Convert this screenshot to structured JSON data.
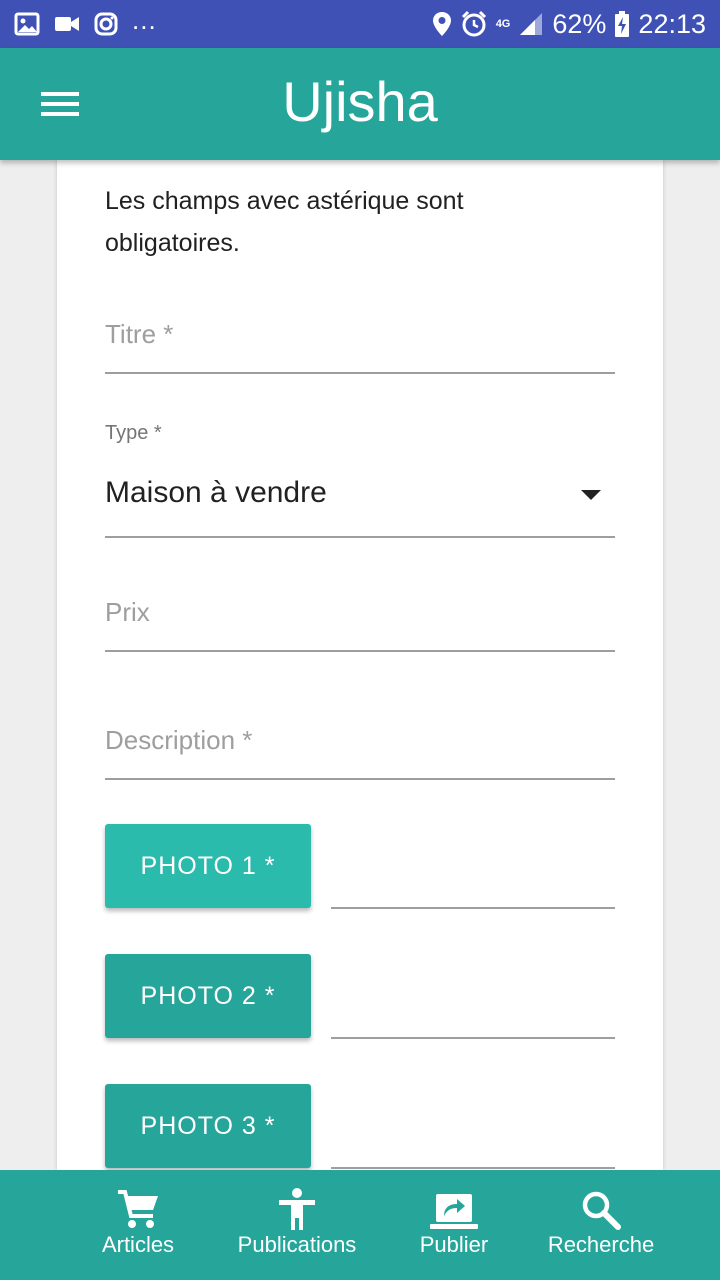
{
  "status_bar": {
    "more": "...",
    "network": "4G",
    "battery": "62%",
    "time": "22:13",
    "icons": [
      "image-icon",
      "video-icon",
      "instagram-icon",
      "location-icon",
      "alarm-icon",
      "signal-icon",
      "battery-charging-icon"
    ]
  },
  "app_bar": {
    "title": "Ujisha",
    "menu_icon": "hamburger-menu-icon"
  },
  "form": {
    "intro": "Les champs avec astérique sont obligatoires.",
    "title_placeholder": "Titre *",
    "type_label": "Type *",
    "type_value": "Maison à vendre",
    "price_placeholder": "Prix",
    "description_placeholder": "Description *",
    "photos": [
      {
        "label": "PHOTO 1 *"
      },
      {
        "label": "PHOTO 2 *"
      },
      {
        "label": "PHOTO 3 *"
      }
    ]
  },
  "bottom_nav": {
    "items": [
      {
        "label": "Articles",
        "icon": "cart-icon"
      },
      {
        "label": "Publications",
        "icon": "person-icon"
      },
      {
        "label": "Publier",
        "icon": "share-laptop-icon"
      },
      {
        "label": "Recherche",
        "icon": "search-icon"
      }
    ]
  },
  "colors": {
    "status_bar": "#3f51b5",
    "primary": "#26a69a",
    "primary_light": "#2bbbad",
    "background": "#eeeeee"
  }
}
